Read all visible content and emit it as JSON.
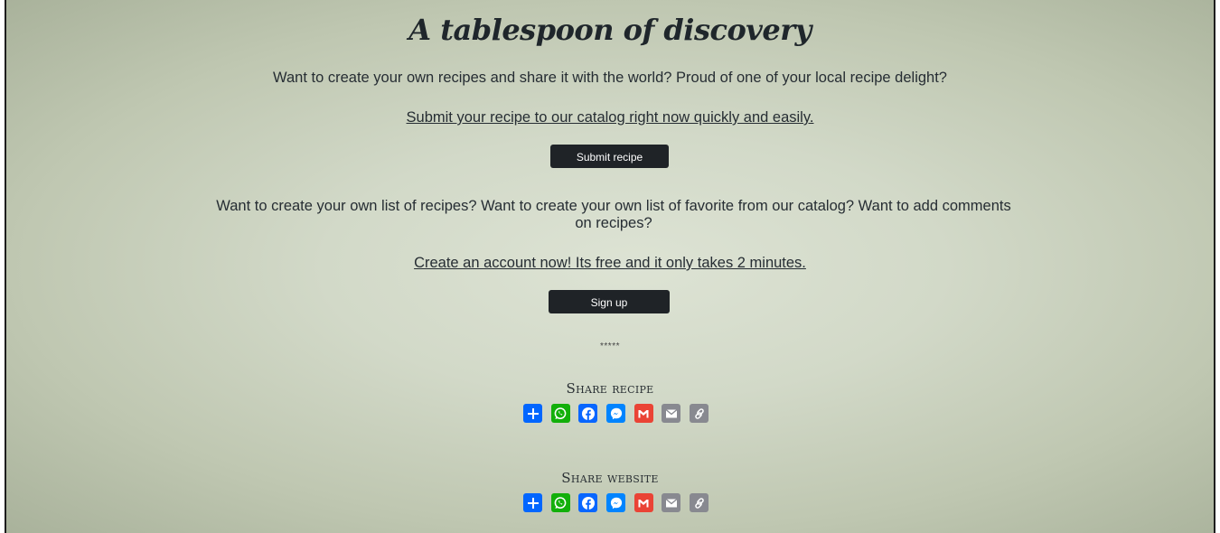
{
  "hero": {
    "title": "A tablespoon of discovery"
  },
  "submit_section": {
    "text": "Want to create your own recipes and share it with the world? Proud of one of your local recipe delight?",
    "link": "Submit your recipe to our catalog right now quickly and easily.",
    "button": "Submit recipe"
  },
  "signup_section": {
    "text": "Want to create your own list of recipes? Want to create your own list of favorite from our catalog? Want to add comments on recipes?",
    "link": "Create an account now! Its free and it only takes 2 minutes.",
    "button": "Sign up"
  },
  "divider": "*****",
  "share_recipe": {
    "title": "Share recipe",
    "icons": [
      "share-icon",
      "whatsapp-icon",
      "facebook-icon",
      "messenger-icon",
      "gmail-icon",
      "email-icon",
      "copy-link-icon"
    ]
  },
  "share_website": {
    "title": "Share website",
    "icons": [
      "share-icon",
      "whatsapp-icon",
      "facebook-icon",
      "messenger-icon",
      "gmail-icon",
      "email-icon",
      "copy-link-icon"
    ]
  },
  "colors": {
    "share": "#0166ff",
    "whatsapp": "#12af0a",
    "facebook": "#0866ff",
    "messenger": "#0084ff",
    "gmail": "#ea4335",
    "email": "#888990",
    "copy_link": "#888990",
    "button_bg": "#1f2327"
  }
}
